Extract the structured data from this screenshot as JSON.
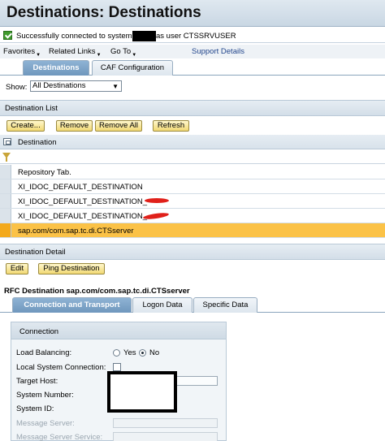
{
  "title": "Destinations: Destinations",
  "status": {
    "message_prefix": "Successfully connected to system",
    "message_suffix": "as user CTSSRVUSER"
  },
  "menu": {
    "favorites": "Favorites",
    "related_links": "Related Links",
    "go_to": "Go To",
    "support_details": "Support Details"
  },
  "top_tabs": [
    {
      "label": "Destinations",
      "active": true
    },
    {
      "label": "CAF Configuration",
      "active": false
    }
  ],
  "show": {
    "label": "Show:",
    "selected": "All Destinations"
  },
  "destination_list": {
    "header": "Destination List",
    "buttons": {
      "create": "Create...",
      "remove": "Remove",
      "remove_all": "Remove All",
      "refresh": "Refresh"
    },
    "column_header": "Destination",
    "rows": [
      "Repository Tab.",
      "XI_IDOC_DEFAULT_DESTINATION",
      "XI_IDOC_DEFAULT_DESTINATION_",
      "XI_IDOC_DEFAULT_DESTINATION_",
      "sap.com/com.sap.tc.di.CTSserver"
    ],
    "selected_index": 4
  },
  "destination_detail": {
    "header": "Destination Detail",
    "buttons": {
      "edit": "Edit",
      "ping": "Ping Destination"
    },
    "rfc_title": "RFC Destination sap.com/com.sap.tc.di.CTSserver",
    "tabs": [
      {
        "label": "Connection and Transport",
        "active": true
      },
      {
        "label": "Logon Data",
        "active": false
      },
      {
        "label": "Specific Data",
        "active": false
      }
    ],
    "connection": {
      "header": "Connection",
      "load_balancing_label": "Load Balancing:",
      "yes": "Yes",
      "no": "No",
      "load_balancing_value": "No",
      "local_system_label": "Local System Connection:",
      "target_host_label": "Target Host:",
      "system_number_label": "System Number:",
      "system_id_label": "System ID:",
      "message_server_label": "Message Server:",
      "message_server_service_label": "Message Server Service:"
    }
  },
  "colors": {
    "selected_row": "#fbc247",
    "tab_active": "#7aa1c6",
    "button_fill": "#f3df8a"
  }
}
